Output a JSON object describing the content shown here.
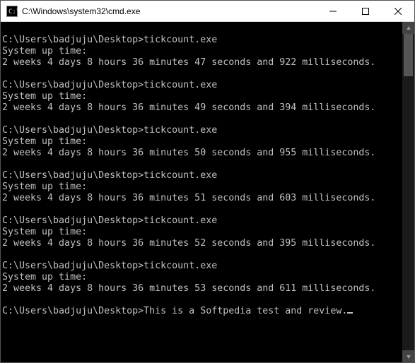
{
  "window": {
    "title": "C:\\Windows\\system32\\cmd.exe",
    "icon_name": "cmd-icon"
  },
  "prompt": "C:\\Users\\badjuju\\Desktop>",
  "uptime_label": "System up time:",
  "runs": [
    {
      "command": "tickcount.exe",
      "result": "2 weeks 4 days 8 hours 36 minutes 47 seconds and 922 milliseconds."
    },
    {
      "command": "tickcount.exe",
      "result": "2 weeks 4 days 8 hours 36 minutes 49 seconds and 394 milliseconds."
    },
    {
      "command": "tickcount.exe",
      "result": "2 weeks 4 days 8 hours 36 minutes 50 seconds and 955 milliseconds."
    },
    {
      "command": "tickcount.exe",
      "result": "2 weeks 4 days 8 hours 36 minutes 51 seconds and 603 milliseconds."
    },
    {
      "command": "tickcount.exe",
      "result": "2 weeks 4 days 8 hours 36 minutes 52 seconds and 395 milliseconds."
    },
    {
      "command": "tickcount.exe",
      "result": "2 weeks 4 days 8 hours 36 minutes 53 seconds and 611 milliseconds."
    }
  ],
  "current_input": "This is a Softpedia test and review."
}
